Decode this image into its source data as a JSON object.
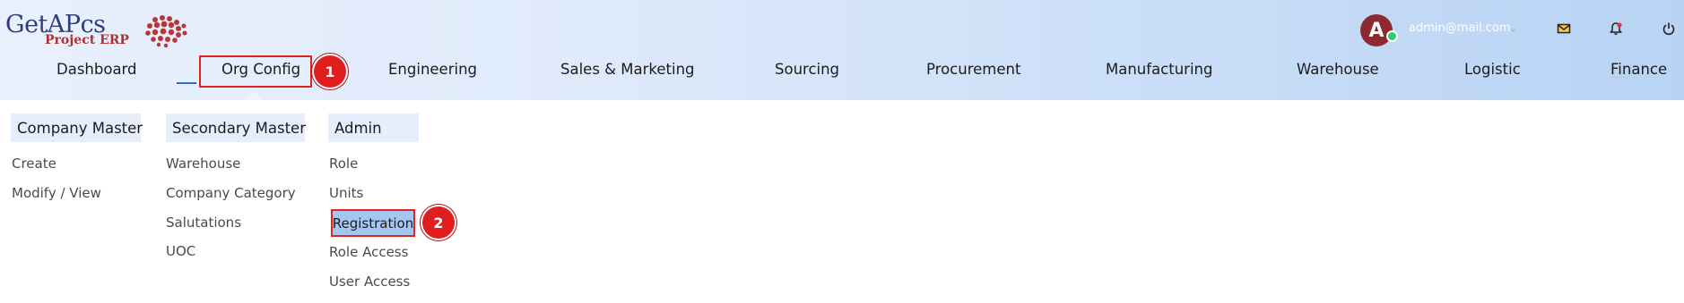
{
  "logo": {
    "text": "GetAPcs",
    "subtext": "Project ERP"
  },
  "user": {
    "avatar_letter": "A",
    "email": "admin@mail.com"
  },
  "header_icons": [
    "mail-icon",
    "bell-icon",
    "power-icon"
  ],
  "nav": {
    "items": [
      {
        "label": "Dashboard"
      },
      {
        "label": "Org Config"
      },
      {
        "label": "Engineering"
      },
      {
        "label": "Sales & Marketing"
      },
      {
        "label": "Sourcing"
      },
      {
        "label": "Procurement"
      },
      {
        "label": "Manufacturing"
      },
      {
        "label": "Warehouse"
      },
      {
        "label": "Logistic"
      },
      {
        "label": "Finance"
      }
    ]
  },
  "annotations": {
    "step1": "1",
    "step2": "2"
  },
  "menu": {
    "columns": [
      {
        "title": "Company Master",
        "links": [
          "Create",
          "Modify / View"
        ]
      },
      {
        "title": "Secondary Master",
        "links": [
          "Warehouse",
          "Company Category",
          "Salutations",
          "UOC"
        ]
      },
      {
        "title": "Admin",
        "links": [
          "Role",
          "Units",
          "Registration",
          "Role Access",
          "User Access"
        ]
      }
    ]
  },
  "colors": {
    "accent_highlight": "#a3c7f1",
    "annotation_red": "#e2231a",
    "avatar": "#8e2a2f",
    "online": "#2ecc71"
  }
}
